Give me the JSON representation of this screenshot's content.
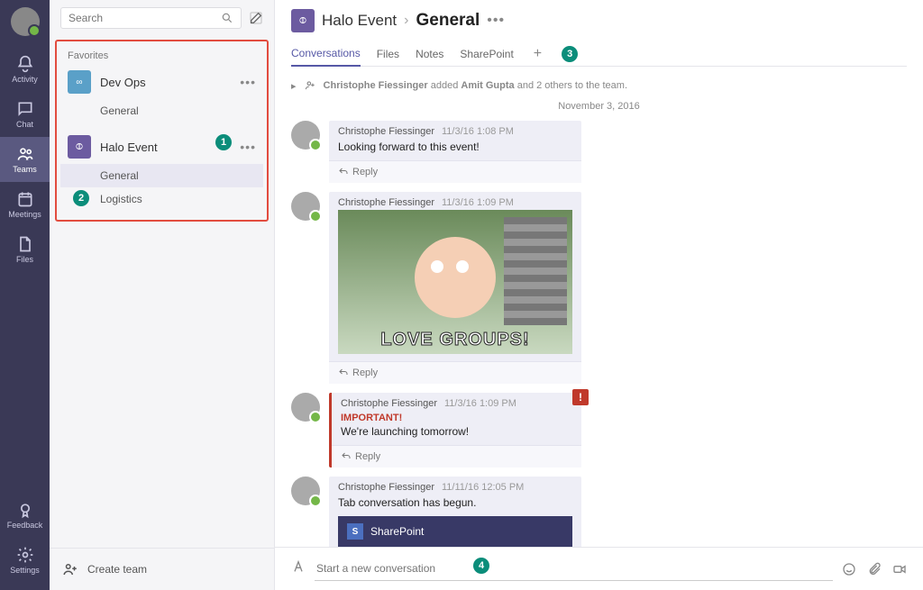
{
  "rail": {
    "items": [
      {
        "label": "Activity"
      },
      {
        "label": "Chat"
      },
      {
        "label": "Teams"
      },
      {
        "label": "Meetings"
      },
      {
        "label": "Files"
      }
    ],
    "bottom": [
      {
        "label": "Feedback"
      },
      {
        "label": "Settings"
      }
    ]
  },
  "search": {
    "placeholder": "Search"
  },
  "favorites": {
    "label": "Favorites",
    "teams": [
      {
        "name": "Dev Ops",
        "channels": [
          {
            "name": "General"
          }
        ]
      },
      {
        "name": "Halo Event",
        "channels": [
          {
            "name": "General"
          },
          {
            "name": "Logistics"
          }
        ]
      }
    ]
  },
  "create_team": "Create team",
  "header": {
    "team": "Halo Event",
    "channel": "General",
    "tabs": [
      {
        "label": "Conversations"
      },
      {
        "label": "Files"
      },
      {
        "label": "Notes"
      },
      {
        "label": "SharePoint"
      }
    ]
  },
  "system_msg": {
    "prefix": "Christophe Fiessinger",
    "middle": " added ",
    "target": "Amit Gupta",
    "suffix": " and 2 others to the team."
  },
  "date": "November 3, 2016",
  "messages": [
    {
      "author": "Christophe Fiessinger",
      "ts": "11/3/16 1:08 PM",
      "body": "Looking forward to this event!",
      "reply": "Reply"
    },
    {
      "author": "Christophe Fiessinger",
      "ts": "11/3/16 1:09 PM",
      "gif_caption": "LOVE GROUPS!",
      "reply": "Reply"
    },
    {
      "author": "Christophe Fiessinger",
      "ts": "11/3/16 1:09 PM",
      "important": "IMPORTANT!",
      "body": "We're launching tomorrow!",
      "reply": "Reply"
    },
    {
      "author": "Christophe Fiessinger",
      "ts": "11/11/16 12:05 PM",
      "body": "Tab conversation has begun.",
      "sharepoint": "SharePoint"
    }
  ],
  "composer": {
    "placeholder": "Start a new conversation"
  },
  "annotations": {
    "a1": "1",
    "a2": "2",
    "a3": "3",
    "a4": "4"
  }
}
